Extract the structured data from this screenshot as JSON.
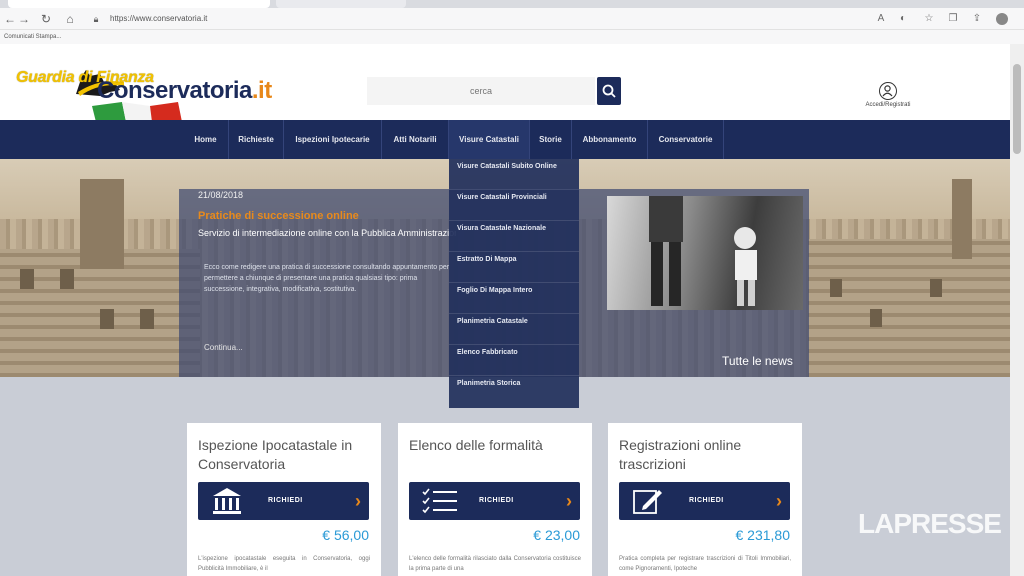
{
  "browser": {
    "url": "https://www.conservatoria.it",
    "bookmark": "Comunicati Stampa...",
    "back_glyph": "←",
    "forward_glyph": "→",
    "reload_glyph": "↻",
    "home_glyph": "⌂"
  },
  "header": {
    "logo_gdf": "Guardia di Finanza",
    "logo_conservatoria": "Conservatoria",
    "logo_tld": ".it",
    "search_placeholder": "cerca",
    "account_label": "Accedi/Registrati"
  },
  "nav": {
    "items": [
      "Home",
      "Richieste",
      "Ispezioni Ipotecarie",
      "Atti Notarili",
      "Visure Catastali",
      "Storie",
      "Abbonamento",
      "Conservatorie"
    ]
  },
  "dropdown": {
    "items": [
      "Visure Catastali Subito Online",
      "Visure Catastali Provinciali",
      "Visura Catastale Nazionale",
      "Estratto Di Mappa",
      "Foglio Di Mappa Intero",
      "Planimetria Catastale",
      "Elenco Fabbricato",
      "Planimetria Storica"
    ]
  },
  "hero": {
    "date": "21/08/2018",
    "title": "Pratiche di successione online",
    "subtitle": "Servizio di intermediazione online con la Pubblica Amministrazione",
    "text": "Ecco come redigere una pratica di successione consultando appuntamento per permettere a chiunque di presentare una pratica qualsiasi tipo: prima successione, integrativa, modificativa, sostitutiva.",
    "continue_label": "Continua...",
    "all_news": "Tutte le news"
  },
  "cards": [
    {
      "title": "Ispezione Ipocatastale in Conservatoria",
      "button": "RICHIEDI",
      "price": "€ 56,00",
      "desc": "L'ispezione ipocatastale eseguita in Conservatoria, oggi Pubblicità Immobiliare, è il",
      "icon": "bank-icon"
    },
    {
      "title": "Elenco delle formalità",
      "button": "RICHIEDI",
      "price": "€ 23,00",
      "desc": "L'elenco delle formalità rilasciato dalla Conservatoria costituisce la prima parte di una",
      "icon": "checklist-icon"
    },
    {
      "title": "Registrazioni online trascrizioni",
      "button": "RICHIEDI",
      "price": "€ 231,80",
      "desc": "Pratica completa per registrare trascrizioni di Titoli Immobiliari, come Pignoramenti, Ipoteche",
      "icon": "edit-icon"
    }
  ],
  "watermark": "LAPRESSE",
  "colors": {
    "nav_bg": "#1c2b5a",
    "accent_orange": "#e8881a",
    "price_blue": "#2a9ad6",
    "logo_yellow": "#f2c200"
  }
}
